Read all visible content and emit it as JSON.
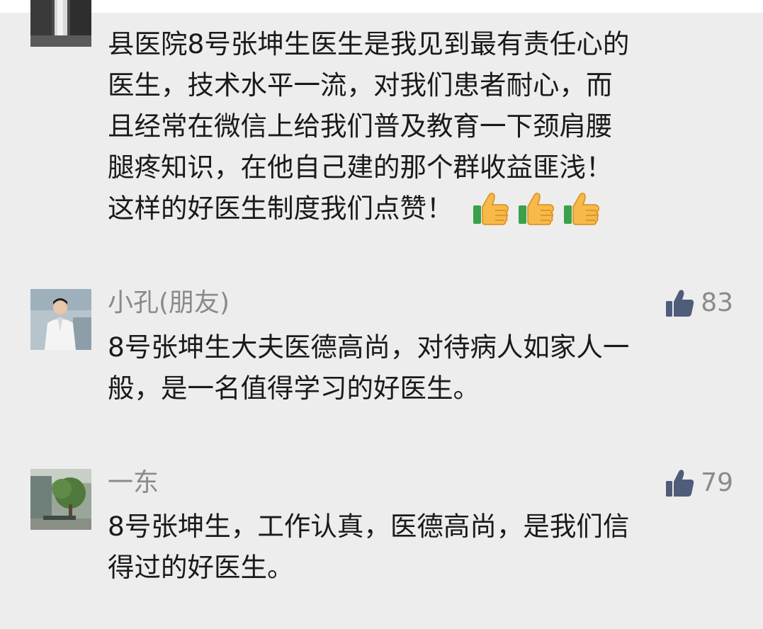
{
  "comments": [
    {
      "author": "",
      "likes": "",
      "lines": [
        "县医院8号张坤生医生是我见到最有责任心的",
        "医生，技术水平一流，对我们患者耐心，而",
        "且经常在微信上给我们普及教育一下颈肩腰",
        "腿疼知识，在他自己建的那个群收益匪浅！",
        "这样的好医生制度我们点赞！"
      ],
      "emoji": [
        "thumbs-up",
        "thumbs-up",
        "thumbs-up"
      ]
    },
    {
      "author": "小孔(朋友)",
      "likes": "83",
      "lines": [
        "8号张坤生大夫医德高尚，对待病人如家人一",
        "般，是一名值得学习的好医生。"
      ]
    },
    {
      "author": "一东",
      "likes": "79",
      "lines": [
        "8号张坤生，工作认真，医德高尚，是我们信",
        "得过的好医生。"
      ]
    }
  ],
  "colors": {
    "background": "#ededed",
    "text": "#1a1a1a",
    "meta": "#8a8a8a",
    "like_icon": "#4f5c7a"
  }
}
